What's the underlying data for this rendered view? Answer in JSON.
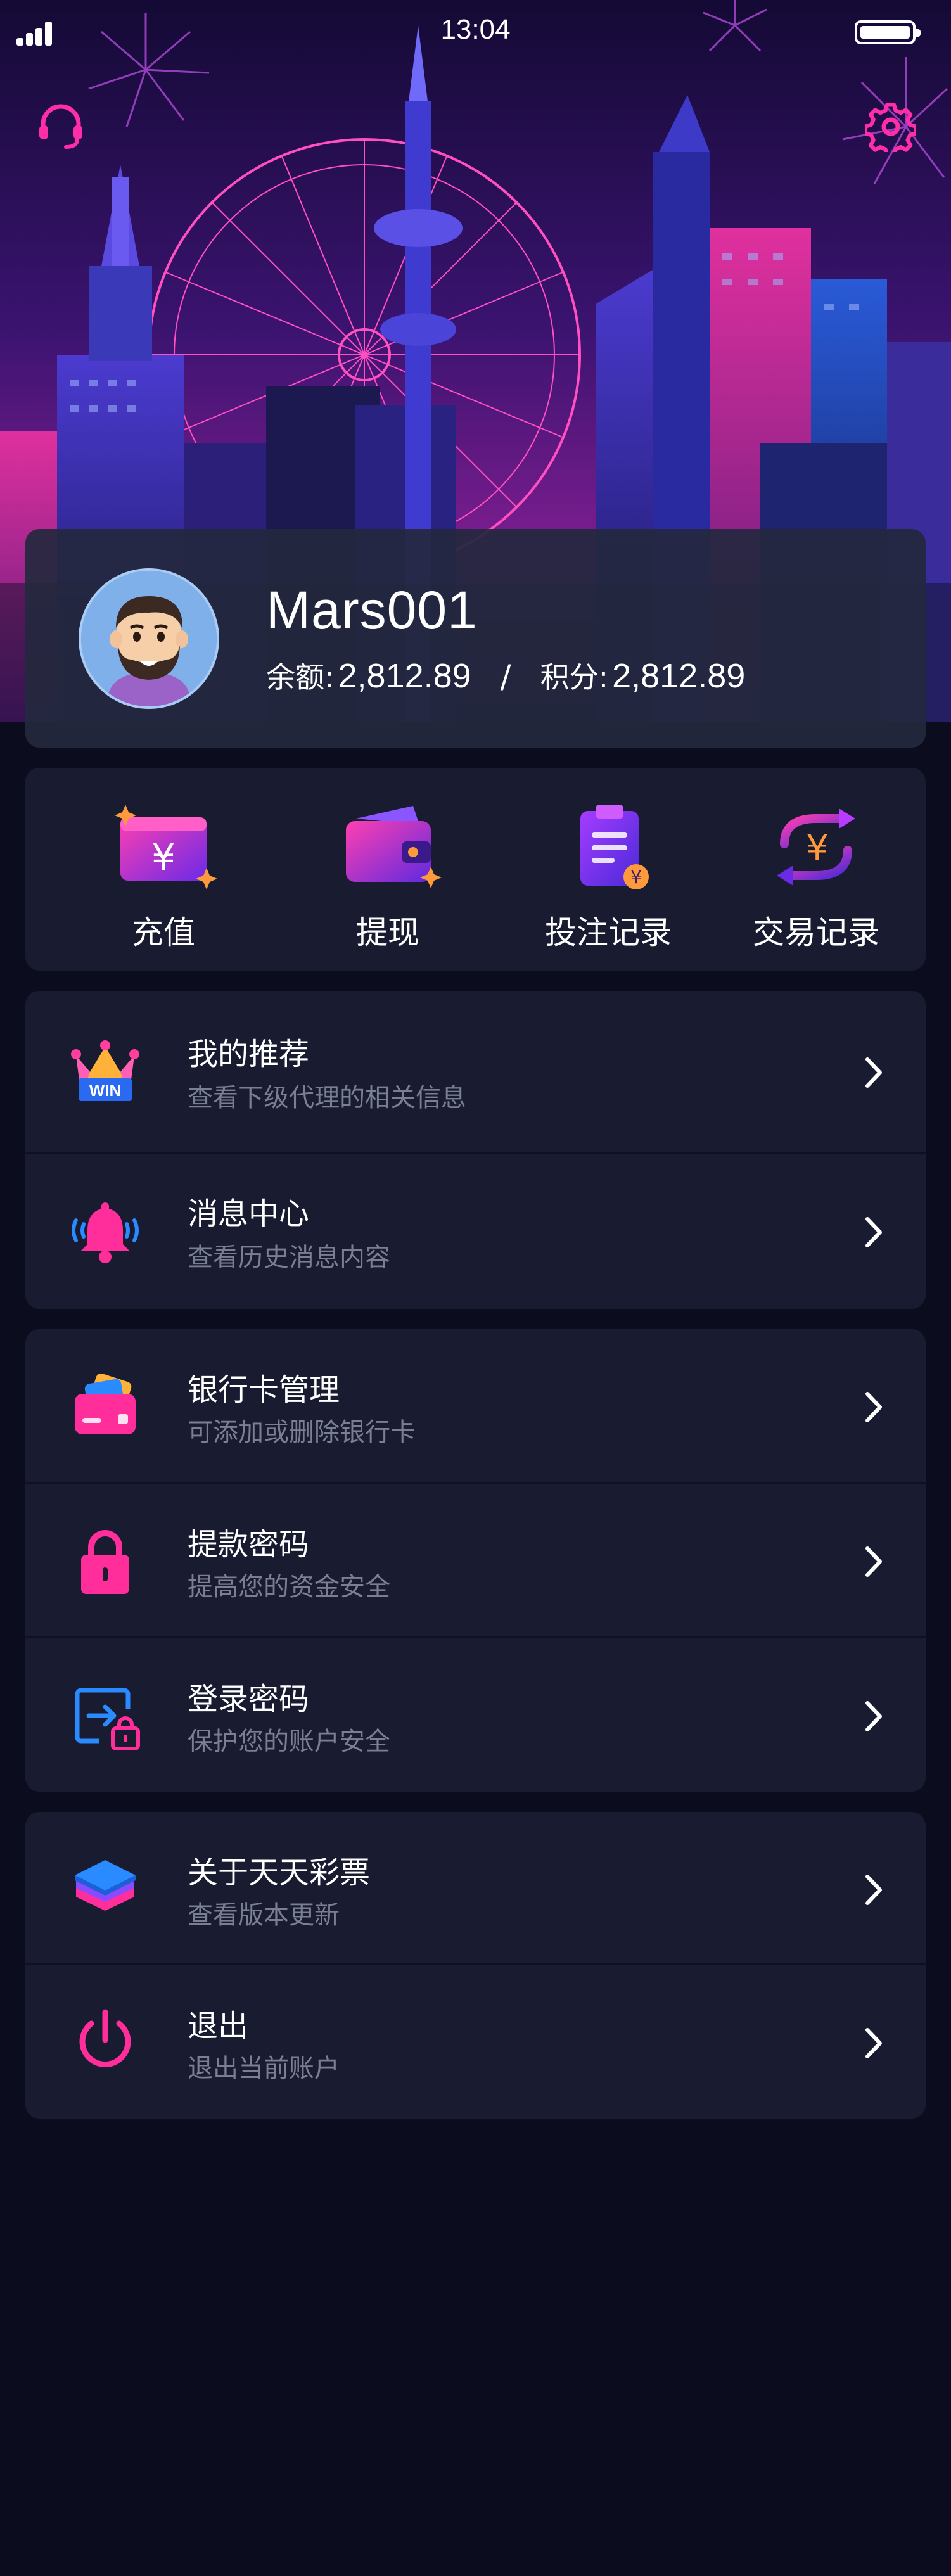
{
  "status_bar": {
    "time": "13:04"
  },
  "profile": {
    "username": "Mars001",
    "balance_label": "余额:",
    "balance_value": "2,812.89",
    "separator": "/",
    "points_label": "积分:",
    "points_value": "2,812.89"
  },
  "quick_actions": [
    {
      "label": "充值",
      "icon": "recharge-card-icon"
    },
    {
      "label": "提现",
      "icon": "wallet-icon"
    },
    {
      "label": "投注记录",
      "icon": "bet-clipboard-icon"
    },
    {
      "label": "交易记录",
      "icon": "exchange-icon"
    }
  ],
  "menu_groups": [
    {
      "items": [
        {
          "title": "我的推荐",
          "subtitle": "查看下级代理的相关信息",
          "icon": "crown-win-icon"
        },
        {
          "title": "消息中心",
          "subtitle": "查看历史消息内容",
          "icon": "bell-icon"
        }
      ]
    },
    {
      "items": [
        {
          "title": "银行卡管理",
          "subtitle": "可添加或删除银行卡",
          "icon": "bank-card-icon"
        },
        {
          "title": "提款密码",
          "subtitle": "提高您的资金安全",
          "icon": "padlock-icon"
        },
        {
          "title": "登录密码",
          "subtitle": "保护您的账户安全",
          "icon": "login-lock-icon"
        }
      ]
    },
    {
      "items": [
        {
          "title": "关于天天彩票",
          "subtitle": "查看版本更新",
          "icon": "layers-icon"
        },
        {
          "title": "退出",
          "subtitle": "退出当前账户",
          "icon": "power-icon"
        }
      ]
    }
  ],
  "colors": {
    "background": "#0b0d1e",
    "card": "#191c30",
    "accent_pink": "#ff2e9a",
    "accent_purple": "#8a2be2"
  }
}
